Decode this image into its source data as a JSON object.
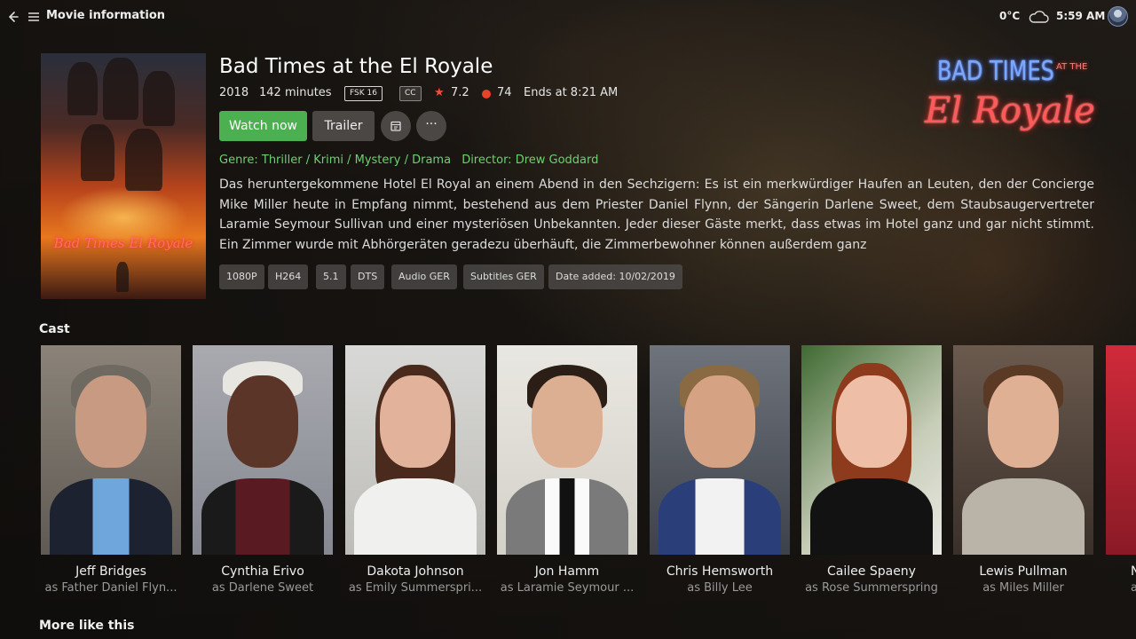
{
  "header": {
    "back_icon": "arrow-left-icon",
    "menu_icon": "hamburger-menu-icon",
    "title": "Movie information",
    "temperature": "0°C",
    "weather_icon": "cloud-icon",
    "time": "5:59 AM"
  },
  "movie": {
    "title": "Bad Times at the El Royale",
    "year": "2018",
    "runtime": "142 minutes",
    "age_rating": "FSK 16",
    "cc": "CC",
    "rating": "7.2",
    "critic_score": "74",
    "ends_at": "Ends at 8:21 AM",
    "genre": "Genre: Thriller / Krimi / Mystery / Drama",
    "director": "Director: Drew Goddard",
    "synopsis": "Das heruntergekommene Hotel El Royal an einem Abend in den Sechzigern: Es ist ein merkwürdiger Haufen an Leuten, den der Concierge Mike Miller heute in Empfang nimmt, bestehend aus dem Priester Daniel Flynn, der Sängerin Darlene Sweet, dem Staubsaugervertreter Laramie Seymour Sullivan und einer mysteriösen Unbekannten. Jeder dieser Gäste merkt, dass etwas im Hotel ganz und gar nicht stimmt. Ein Zimmer wurde mit Abhörgeräten geradezu überhäuft, die Zimmerbewohner können außerdem ganz",
    "logo_line1": "BAD TIMES",
    "logo_line2": "AT THE",
    "logo_line3": "El Royale",
    "poster_title": "Bad Times El Royale"
  },
  "actions": {
    "watch": "Watch now",
    "trailer": "Trailer",
    "calendar_icon": "calendar-icon",
    "more_icon": "more-horizontal-icon",
    "more_symbol": "···"
  },
  "tags": [
    "1080P",
    "H264",
    "5.1",
    "DTS",
    "Audio GER",
    "Subtitles GER",
    "Date added: 10/02/2019"
  ],
  "cast": {
    "title": "Cast",
    "members": [
      {
        "name": "Jeff Bridges",
        "role": "as Father Daniel Flyn..."
      },
      {
        "name": "Cynthia Erivo",
        "role": "as Darlene Sweet"
      },
      {
        "name": "Dakota Johnson",
        "role": "as Emily Summerspri..."
      },
      {
        "name": "Jon Hamm",
        "role": "as Laramie Seymour ..."
      },
      {
        "name": "Chris Hemsworth",
        "role": "as Billy Lee"
      },
      {
        "name": "Cailee Spaeny",
        "role": "as Rose Summerspring"
      },
      {
        "name": "Lewis Pullman",
        "role": "as Miles Miller"
      },
      {
        "name": "N",
        "role": "a"
      }
    ]
  },
  "more_like_this": {
    "title": "More like this"
  }
}
